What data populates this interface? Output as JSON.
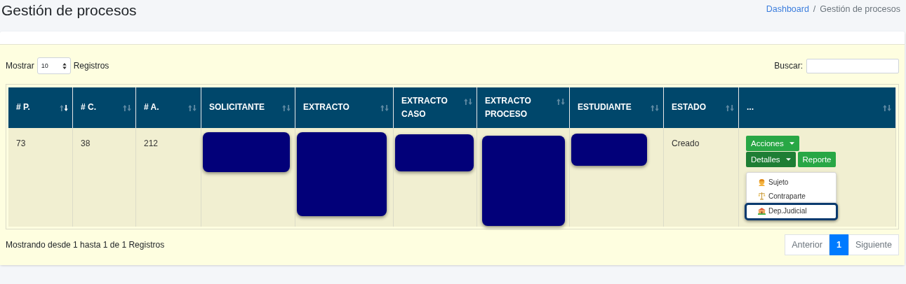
{
  "page_title": "Gestión de procesos",
  "breadcrumb": [
    {
      "label": "Dashboard",
      "kind": "link"
    },
    {
      "label": "Gestión de procesos",
      "kind": "current"
    }
  ],
  "breadcrumb_separator": "/",
  "length_control": {
    "before": "Mostrar",
    "value": "10",
    "after": "Registros"
  },
  "search": {
    "label": "Buscar:"
  },
  "table": {
    "columns": [
      {
        "label": "# P.",
        "sorted": true
      },
      {
        "label": "# C.",
        "sorted": false
      },
      {
        "label": "# A.",
        "sorted": false
      },
      {
        "label": "SOLICITANTE",
        "sorted": false
      },
      {
        "label": "EXTRACTO",
        "sorted": false
      },
      {
        "label": "EXTRACTO CASO",
        "sorted": false
      },
      {
        "label": "EXTRACTO PROCESO",
        "sorted": false
      },
      {
        "label": "ESTUDIANTE",
        "sorted": false
      },
      {
        "label": "ESTADO",
        "sorted": false
      },
      {
        "label": "...",
        "sorted": false
      }
    ],
    "rows": [
      {
        "cells": [
          {
            "kind": "text",
            "text": "73"
          },
          {
            "kind": "text",
            "text": "38"
          },
          {
            "kind": "text",
            "text": "212"
          },
          {
            "kind": "redacted"
          },
          {
            "kind": "redacted"
          },
          {
            "kind": "redacted"
          },
          {
            "kind": "redacted"
          },
          {
            "kind": "redacted"
          },
          {
            "kind": "text",
            "text": "Creado"
          },
          {
            "kind": "actions",
            "buttons": [
              {
                "label": "Acciones",
                "caret": true,
                "pressed": false
              },
              {
                "label": "Detalles",
                "caret": true,
                "pressed": true
              },
              {
                "label": "Reporte",
                "caret": false,
                "pressed": false
              }
            ],
            "menu": [
              {
                "label": "Sujeto",
                "focused": false
              },
              {
                "label": "Contraparte",
                "focused": false
              },
              {
                "label": "Dep.Judicial",
                "focused": true
              }
            ]
          }
        ]
      }
    ]
  },
  "info": "Mostrando desde 1 hasta 1 de 1 Registros",
  "pagination": [
    {
      "label": "Anterior",
      "selected": false
    },
    {
      "label": "1",
      "selected": true
    },
    {
      "label": "Siguiente",
      "selected": false
    }
  ]
}
